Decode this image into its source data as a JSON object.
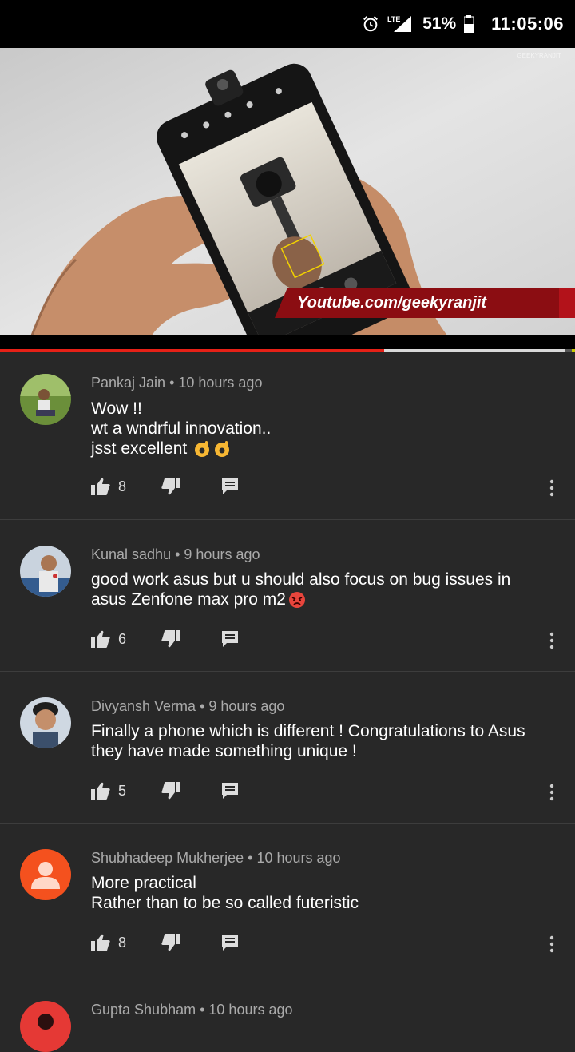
{
  "status_bar": {
    "network": "LTE",
    "battery_percent": "51%",
    "time": "11:05:06"
  },
  "video": {
    "overlay_banner": "Youtube.com/geekyranjit",
    "watermark": "GEEKYRANJIT",
    "progress_played": 0.668
  },
  "comments": [
    {
      "author": "Pankaj Jain",
      "time": "10 hours ago",
      "lines": [
        "Wow !!",
        "wt a wndrful innovation..",
        "jsst excellent"
      ],
      "emoji": "ok-hand x2",
      "likes": "8",
      "avatar": "photo-person-outdoors"
    },
    {
      "author": "Kunal sadhu",
      "time": "9 hours ago",
      "lines": [
        "good work asus but u should also focus on bug issues in",
        "asus Zenfone max pro m2"
      ],
      "emoji": "angry-face",
      "likes": "6",
      "avatar": "photo-person"
    },
    {
      "author": "Divyansh Verma",
      "time": "9 hours ago",
      "lines": [
        "Finally a phone which is different ! Congratulations to Asus",
        "they have made something unique !"
      ],
      "likes": "5",
      "avatar": "photo-selfie"
    },
    {
      "author": "Shubhadeep Mukherjee",
      "time": "10 hours ago",
      "lines": [
        "More practical",
        "Rather than to be so called futeristic"
      ],
      "likes": "8",
      "avatar": "default-user"
    },
    {
      "author": "Gupta Shubham",
      "time": "10 hours ago",
      "avatar": "red-avatar"
    }
  ],
  "colors": {
    "background": "#282828",
    "accent_red": "#e62117",
    "meta_text": "#aaaaaa",
    "divider": "#3d3d3d"
  }
}
